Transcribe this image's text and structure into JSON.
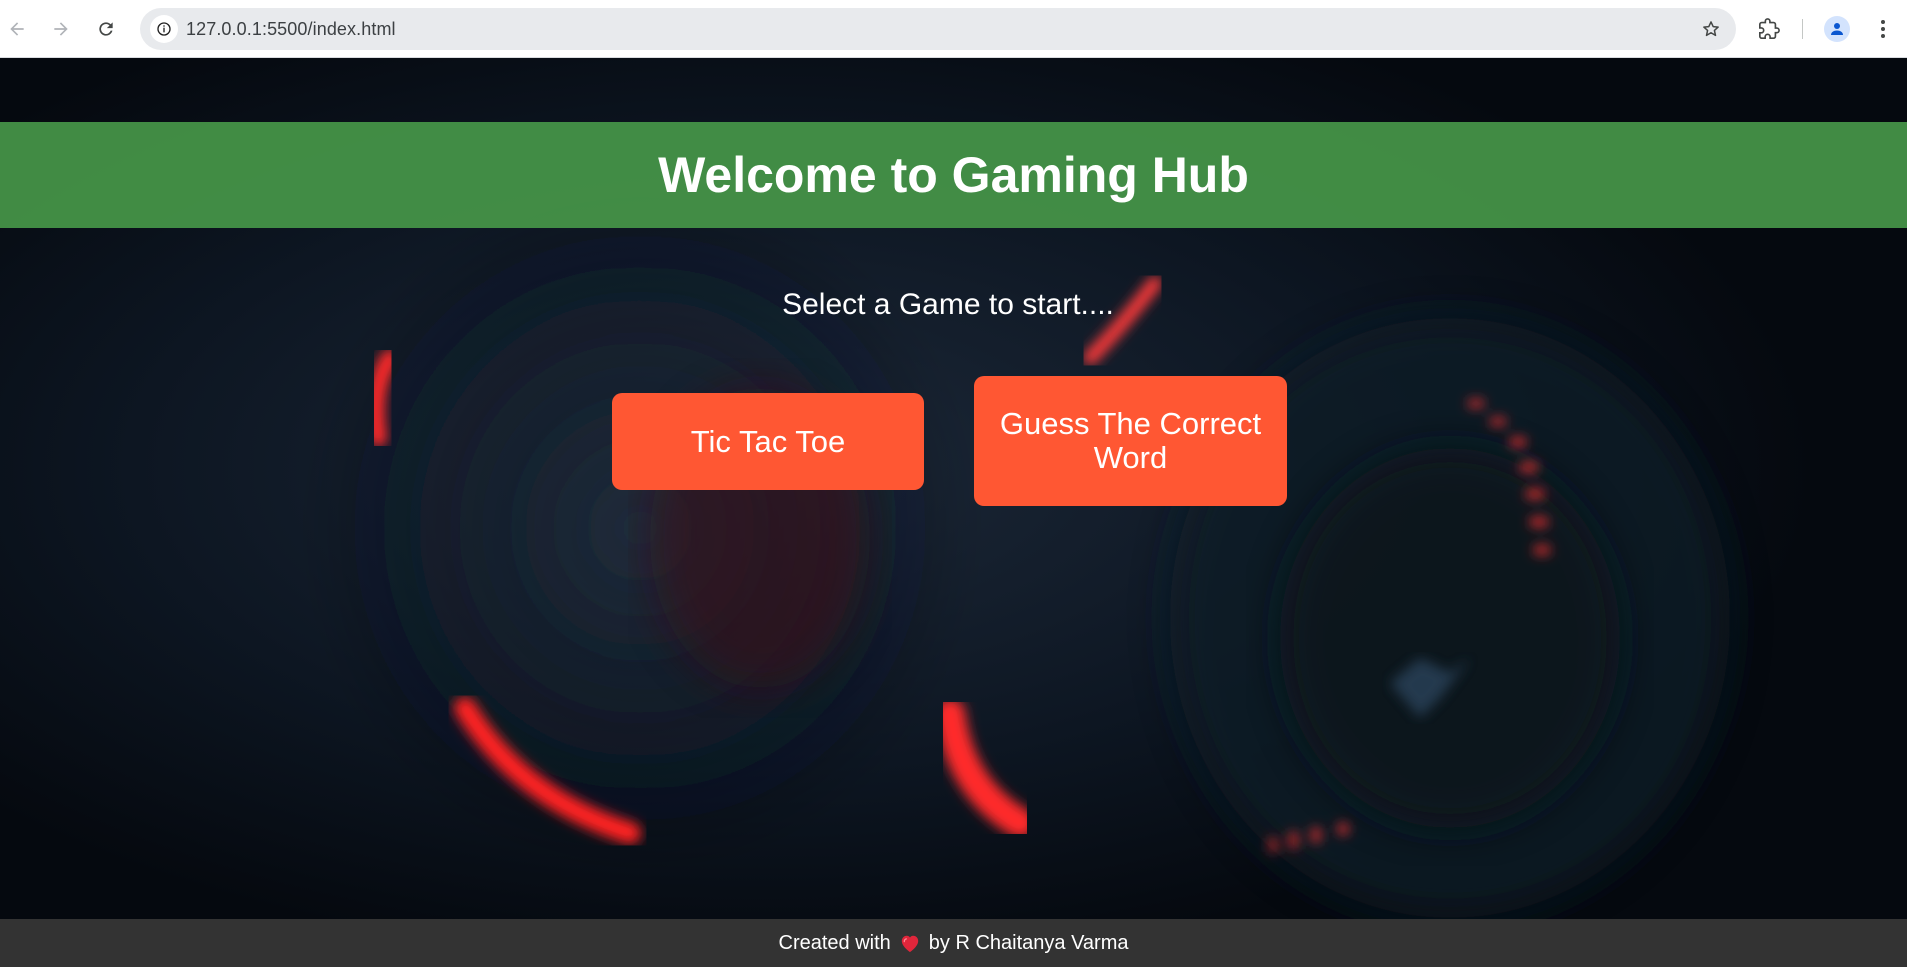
{
  "browser": {
    "url": "127.0.0.1:5500/index.html",
    "icons": [
      "back-arrow-icon",
      "forward-arrow-icon",
      "reload-icon",
      "info-icon",
      "star-icon",
      "extensions-icon",
      "profile-icon",
      "kebab-menu-icon"
    ]
  },
  "page": {
    "header": {
      "title": "Welcome to Gaming Hub",
      "color": "#469648"
    },
    "subtitle": "Select a Game to start....",
    "games": [
      {
        "label": "Tic Tac Toe",
        "color": "#ff5733"
      },
      {
        "label": "Guess The Correct Word",
        "color": "#ff5733"
      }
    ],
    "footer": {
      "prefix": "Created with",
      "icon": "heart-icon",
      "suffix": "by R Chaitanya Varma",
      "color": "#333333"
    }
  }
}
